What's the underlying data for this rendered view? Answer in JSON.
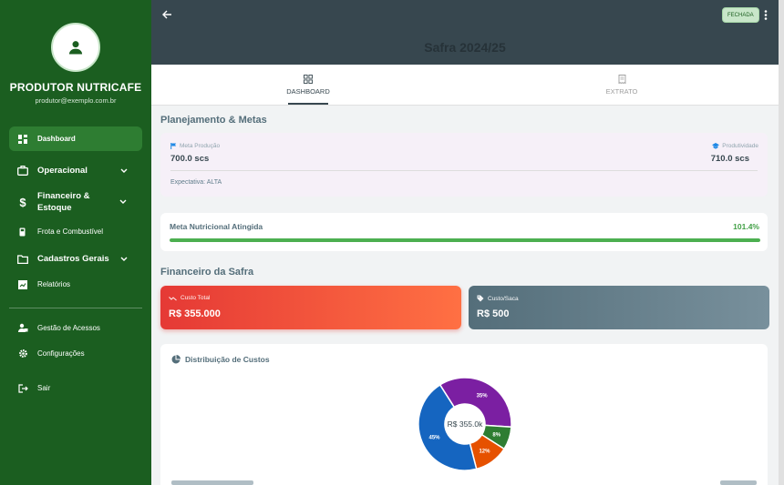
{
  "sidebar": {
    "profile_name": "PRODUTOR NUTRICAFE",
    "profile_email": "produtor@exemplo.com.br",
    "items": [
      {
        "label": "Dashboard",
        "icon": "dashboard-icon"
      },
      {
        "label": "Operacional",
        "icon": "briefcase-icon"
      },
      {
        "label": "Financeiro & Estoque",
        "icon": "dollar-icon"
      },
      {
        "label": "Frota e Combustível",
        "icon": "fuel-icon"
      },
      {
        "label": "Cadastros Gerais",
        "icon": "folder-icon"
      },
      {
        "label": "Relatórios",
        "icon": "report-icon"
      },
      {
        "label": "Gestão de Acessos",
        "icon": "lock-people-icon"
      },
      {
        "label": "Configurações",
        "icon": "gear-icon"
      },
      {
        "label": "Sair",
        "icon": "logout-icon"
      }
    ]
  },
  "header": {
    "title": "Safra 2024/25",
    "status": "FECHADA"
  },
  "tabs": [
    {
      "label": "DASHBOARD",
      "icon": "grid-icon"
    },
    {
      "label": "EXTRATO",
      "icon": "receipt-icon"
    }
  ],
  "planejamento": {
    "section_title": "Planejamento & Metas",
    "meta_label": "Meta Produção",
    "meta_value": "700.0 scs",
    "prod_label": "Produtividade",
    "prod_value": "710.0 scs",
    "expectativa": "Expectativa: ALTA"
  },
  "meta_nutricional": {
    "label": "Meta Nutricional Atingida",
    "percent_text": "101.4%",
    "progress": 1.0
  },
  "financeiro": {
    "section_title": "Financeiro da Safra",
    "custo_total_label": "Custo Total",
    "custo_total_value": "R$ 355.000",
    "custo_saca_label": "Custo/Saca",
    "custo_saca_value": "R$ 500"
  },
  "distribuicao": {
    "title": "Distribuição de Custos",
    "center_label": "R$ 355.0k",
    "slices": [
      {
        "percent": 35,
        "label": "35%",
        "color": "#7b1fa2"
      },
      {
        "percent": 8,
        "label": "8%",
        "color": "#2e7d32"
      },
      {
        "percent": 12,
        "label": "12%",
        "color": "#e65100"
      },
      {
        "percent": 45,
        "label": "45%",
        "color": "#1565c0"
      }
    ]
  },
  "colors": {
    "sidebar": "#1b5e20",
    "topbar": "#37474f",
    "accent_green": "#4caf50",
    "red_card": "#e53935",
    "grey_card": "#607d8b"
  }
}
